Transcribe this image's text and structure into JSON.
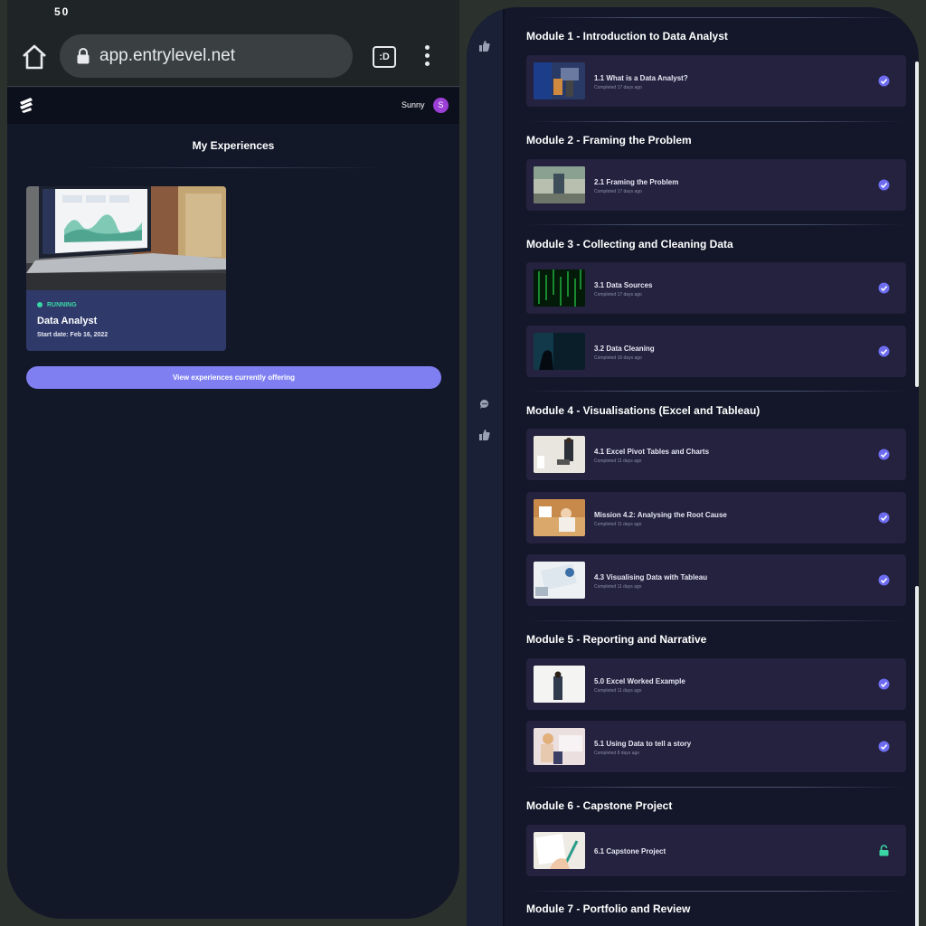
{
  "status_left": {
    "left_text": "50",
    "right_text": ""
  },
  "browser": {
    "url": "app.entrylevel.net",
    "tabs_label": ":D"
  },
  "app": {
    "user_name": "Sunny",
    "user_initial": "S",
    "page_title": "My Experiences",
    "experience": {
      "status": "RUNNING",
      "title": "Data Analyst",
      "start_date": "Start date: Feb 16, 2022"
    },
    "offer_button": "View experiences currently offering"
  },
  "modules": [
    {
      "title": "Module 1 - Introduction to Data Analyst",
      "lessons": [
        {
          "title": "1.1 What is a Data Analyst?",
          "sub": "Completed 17 days ago",
          "state": "done"
        }
      ]
    },
    {
      "title": "Module 2 - Framing the Problem",
      "lessons": [
        {
          "title": "2.1 Framing the Problem",
          "sub": "Completed 17 days ago",
          "state": "done"
        }
      ]
    },
    {
      "title": "Module 3 - Collecting and Cleaning Data",
      "lessons": [
        {
          "title": "3.1 Data Sources",
          "sub": "Completed 17 days ago",
          "state": "done"
        },
        {
          "title": "3.2 Data Cleaning",
          "sub": "Completed 16 days ago",
          "state": "done"
        }
      ]
    },
    {
      "title": "Module 4 - Visualisations (Excel and Tableau)",
      "lessons": [
        {
          "title": "4.1 Excel Pivot Tables and Charts",
          "sub": "Completed 11 days ago",
          "state": "done"
        },
        {
          "title": "Mission 4.2: Analysing the Root Cause",
          "sub": "Completed 11 days ago",
          "state": "done"
        },
        {
          "title": "4.3 Visualising Data with Tableau",
          "sub": "Completed 11 days ago",
          "state": "done"
        }
      ]
    },
    {
      "title": "Module 5 - Reporting and Narrative",
      "lessons": [
        {
          "title": "5.0 Excel Worked Example",
          "sub": "Completed 11 days ago",
          "state": "done"
        },
        {
          "title": "5.1 Using Data to tell a story",
          "sub": "Completed 8 days ago",
          "state": "done"
        }
      ]
    },
    {
      "title": "Module 6 - Capstone Project",
      "lessons": [
        {
          "title": "6.1 Capstone Project",
          "sub": "",
          "state": "unlocked"
        }
      ]
    },
    {
      "title": "Module 7 - Portfolio and Review",
      "lessons": []
    }
  ],
  "colors": {
    "accent": "#7f7ff2",
    "running": "#3ad7a4",
    "check": "#6d6cf0",
    "unlock": "#3ad7a4"
  }
}
